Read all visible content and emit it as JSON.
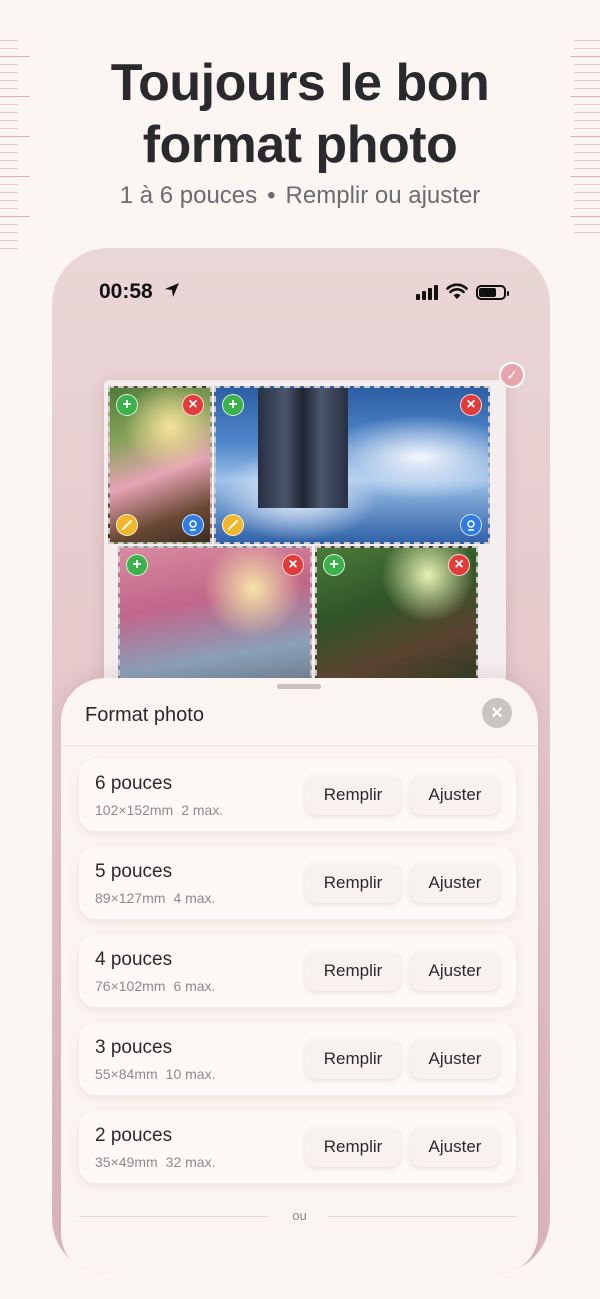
{
  "headline": {
    "line1": "Toujours le bon",
    "line2": "format photo"
  },
  "subline": {
    "part1": "1 à 6 pouces",
    "separator": "•",
    "part2": "Remplir ou ajuster"
  },
  "status_bar": {
    "time": "00:58",
    "icons": [
      "location-arrow-icon",
      "cellular-signal-icon",
      "wifi-icon",
      "battery-icon"
    ]
  },
  "preview": {
    "selected_badge": "✓",
    "photos": [
      {
        "controls": [
          "add",
          "delete",
          "edit",
          "face-detect"
        ]
      },
      {
        "controls": [
          "add",
          "delete",
          "edit",
          "face-detect"
        ]
      },
      {
        "controls": [
          "add",
          "delete"
        ]
      },
      {
        "controls": [
          "add",
          "delete"
        ]
      }
    ],
    "add_glyph": "+",
    "delete_glyph": "×"
  },
  "sheet": {
    "title": "Format photo",
    "close_glyph": "×",
    "fill_label": "Remplir",
    "fit_label": "Ajuster",
    "formats": [
      {
        "name": "6 pouces",
        "size": "102×152mm",
        "max": "2 max."
      },
      {
        "name": "5 pouces",
        "size": "89×127mm",
        "max": "4 max."
      },
      {
        "name": "4 pouces",
        "size": "76×102mm",
        "max": "6 max."
      },
      {
        "name": "3 pouces",
        "size": "55×84mm",
        "max": "10 max."
      },
      {
        "name": "2 pouces",
        "size": "35×49mm",
        "max": "32 max."
      }
    ],
    "or_text": "ou"
  },
  "colors": {
    "background": "#fbf6f2",
    "phone_frame": "#e3c3c6",
    "add_button": "#3ab14a",
    "delete_button": "#e23b3b",
    "edit_button": "#f1b62a",
    "face_button": "#2f7de1"
  }
}
